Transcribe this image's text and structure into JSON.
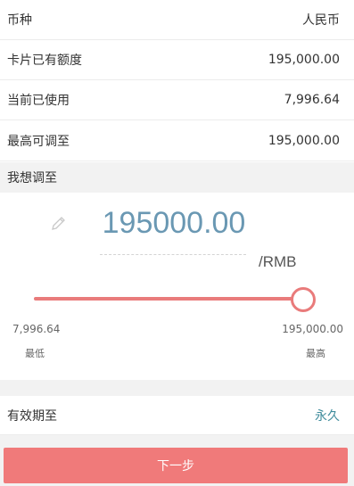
{
  "rows": [
    {
      "label": "币种",
      "value": "人民币"
    },
    {
      "label": "卡片已有额度",
      "value": "195,000.00"
    },
    {
      "label": "当前已使用",
      "value": "7,996.64"
    },
    {
      "label": "最高可调至",
      "value": "195,000.00"
    }
  ],
  "adjust": {
    "header": "我想调至",
    "amount": "195000.00",
    "unit": "/RMB",
    "slider": {
      "min_value": "7,996.64",
      "min_label": "最低",
      "max_value": "195,000.00",
      "max_label": "最高",
      "position": 1.0
    }
  },
  "expiry": {
    "label": "有效期至",
    "value": "永久"
  },
  "next_button": "下一步",
  "colors": {
    "accent_red": "#f07a7a",
    "amount_blue": "#6a98b3",
    "link_teal": "#3f8c9c"
  }
}
